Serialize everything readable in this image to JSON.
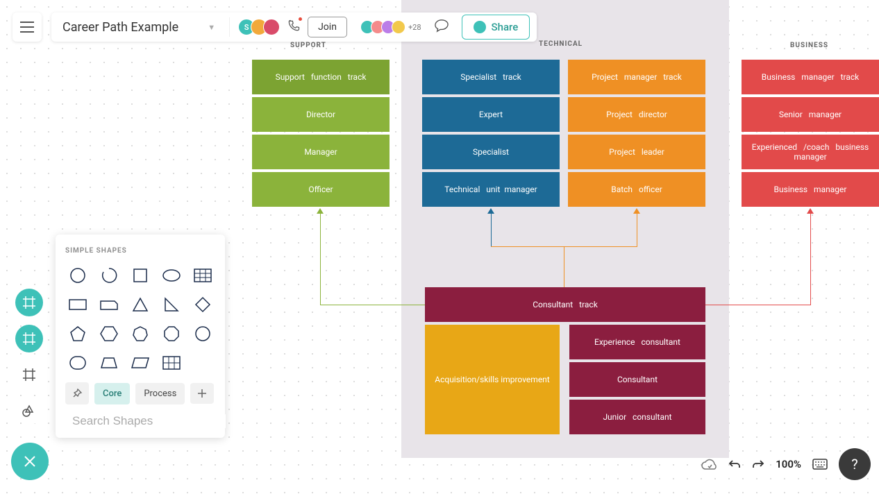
{
  "header": {
    "title": "Career Path Example",
    "joinLabel": "Join",
    "shareLabel": "Share",
    "extraCount": "+28"
  },
  "tracks": {
    "support": {
      "label": "SUPPORT",
      "head": "Support   function   track",
      "rows": [
        "Director",
        "Manager",
        "Officer"
      ]
    },
    "technical": {
      "label": "TECHNICAL",
      "specialist": {
        "head": "Specialist   track",
        "rows": [
          "Expert",
          "Specialist",
          "Technical   unit  manager"
        ]
      },
      "project": {
        "head": "Project   manager   track",
        "rows": [
          "Project   director",
          "Project   leader",
          "Batch   officer"
        ]
      }
    },
    "business": {
      "label": "BUSINESS",
      "head": "Business   manager   track",
      "rows": [
        "Senior   manager",
        "Experienced   /coach   business manager",
        "Business   manager"
      ]
    },
    "consultant": {
      "head": "Consultant   track",
      "acquisition": "Acquisition/skills improvement",
      "levels": [
        "Experience   consultant",
        "Consultant",
        "Junior   consultant"
      ]
    }
  },
  "shapesPanel": {
    "title": "SIMPLE SHAPES",
    "chips": {
      "core": "Core",
      "process": "Process"
    },
    "searchPlaceholder": "Search Shapes"
  },
  "statusBar": {
    "zoom": "100%"
  }
}
